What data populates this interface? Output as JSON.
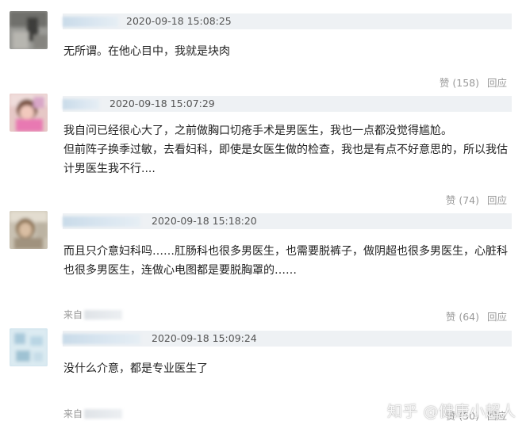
{
  "comments": [
    {
      "timestamp": "2020-09-18 15:08:25",
      "lines": [
        "无所谓。在他心目中，我就是块肉"
      ],
      "like_label": "赞 (158)",
      "reply_label": "回应"
    },
    {
      "timestamp": "2020-09-18 15:07:29",
      "lines": [
        "我自问已经很心大了，之前做胸口切疮手术是男医生，我也一点都没觉得尴尬。",
        "但前阵子换季过敏，去看妇科，即使是女医生做的检查，我也是有点不好意思的，所以我估",
        "计男医生我不行...."
      ],
      "like_label": "赞 (74)",
      "reply_label": "回应"
    },
    {
      "timestamp": "2020-09-18 15:18:20",
      "lines": [
        "而且只介意妇科吗……肛肠科也很多男医生，也需要脱裤子，做阴超也很多男医生，心脏科",
        "也很多男医生，连做心电图都是要脱胸罩的……"
      ],
      "from_label": "来自",
      "like_label": "赞 (64)",
      "reply_label": "回应"
    },
    {
      "timestamp": "2020-09-18 15:09:24",
      "lines": [
        "没什么介意，都是专业医生了"
      ],
      "from_label": "来自",
      "like_label": "赞 (50)",
      "reply_label": "回应"
    }
  ],
  "watermark": "知乎 @健康小超人",
  "colors": {
    "header_bar": "#eef1f4",
    "meta_text": "#999999",
    "body_text": "#222222"
  }
}
